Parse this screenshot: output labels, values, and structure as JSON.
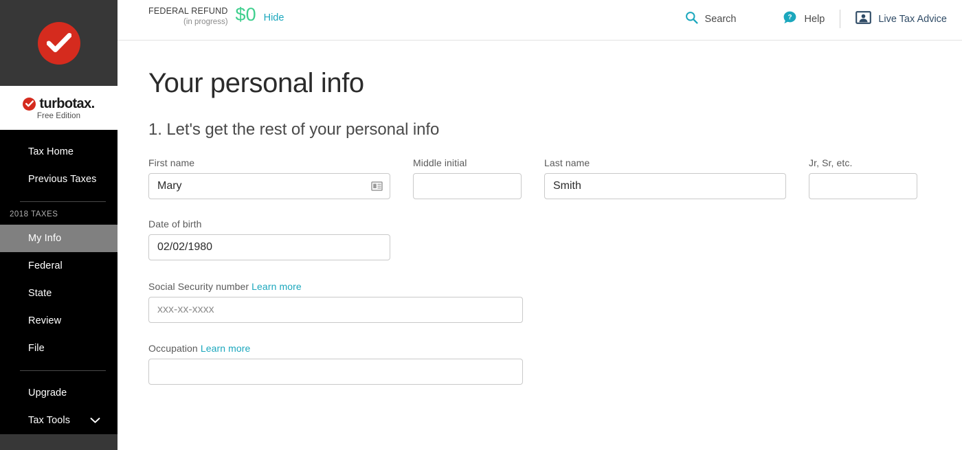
{
  "sidebar": {
    "logo_icon": "checkmark-badge-icon",
    "brand_name": "turbotax",
    "brand_dot": ".",
    "brand_edition": "Free Edition",
    "primary_items": [
      {
        "label": "Tax Home",
        "active": false
      },
      {
        "label": "Previous Taxes",
        "active": false
      }
    ],
    "section_caption": "2018 TAXES",
    "tax_items": [
      {
        "label": "My Info",
        "active": true
      },
      {
        "label": "Federal",
        "active": false
      },
      {
        "label": "State",
        "active": false
      },
      {
        "label": "Review",
        "active": false
      },
      {
        "label": "File",
        "active": false
      }
    ],
    "footer_items": [
      {
        "label": "Upgrade",
        "chevron": false
      },
      {
        "label": "Tax Tools",
        "chevron": true
      }
    ]
  },
  "topbar": {
    "refund_title": "FEDERAL REFUND",
    "refund_status": "(in progress)",
    "refund_amount": "$0",
    "hide_label": "Hide",
    "search_label": "Search",
    "search_icon": "search-icon",
    "help_label": "Help",
    "help_icon": "help-bubble-icon",
    "advice_label": "Live Tax Advice",
    "advice_icon": "live-advisor-icon"
  },
  "main": {
    "page_title": "Your personal info",
    "step_title": "1. Let's get the rest of your personal info",
    "fields": {
      "first_name": {
        "label": "First name",
        "value": "Mary",
        "icon": "contact-card-icon"
      },
      "middle_initial": {
        "label": "Middle initial",
        "value": ""
      },
      "last_name": {
        "label": "Last name",
        "value": "Smith"
      },
      "suffix": {
        "label": "Jr, Sr, etc.",
        "value": ""
      },
      "date_of_birth": {
        "label": "Date of birth",
        "value": "02/02/1980"
      },
      "ssn": {
        "label": "Social Security number",
        "learn_more": "Learn more",
        "placeholder": "xxx-xx-xxxx",
        "value": ""
      },
      "occupation": {
        "label": "Occupation",
        "learn_more": "Learn more",
        "value": ""
      }
    }
  },
  "colors": {
    "brand_red": "#d52b1e",
    "accent_teal": "#1ba7bd",
    "refund_green": "#3fcf8e",
    "advisor_navy": "#2f4b66",
    "sidebar_black": "#000000",
    "sidebar_gray": "#373737",
    "active_item": "#808080"
  }
}
